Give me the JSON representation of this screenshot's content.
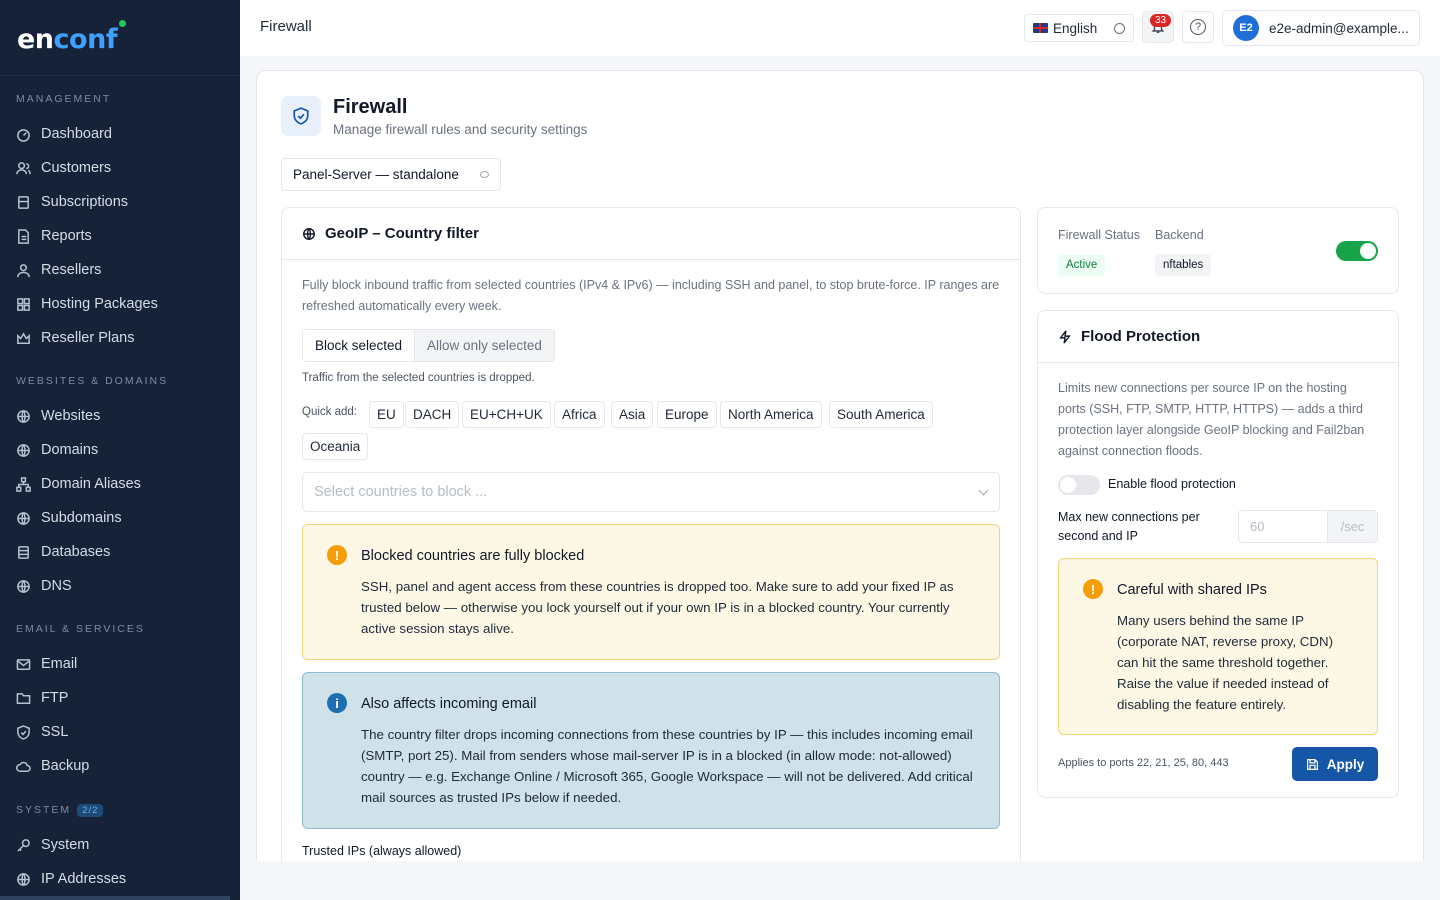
{
  "brand": {
    "part1": "en",
    "part2": "conf"
  },
  "sidebar": {
    "sections": [
      {
        "label": "MANAGEMENT"
      },
      {
        "label": "WEBSITES & DOMAINS"
      },
      {
        "label": "EMAIL & SERVICES"
      },
      {
        "label": "SYSTEM",
        "badge": "2/2"
      }
    ],
    "items": [
      {
        "label": "Dashboard",
        "icon": "dashboard-icon"
      },
      {
        "label": "Customers",
        "icon": "users-icon"
      },
      {
        "label": "Subscriptions",
        "icon": "subscriptions-icon"
      },
      {
        "label": "Reports",
        "icon": "reports-icon"
      },
      {
        "label": "Resellers",
        "icon": "user-icon"
      },
      {
        "label": "Hosting Packages",
        "icon": "grid-icon"
      },
      {
        "label": "Reseller Plans",
        "icon": "crown-icon"
      },
      {
        "label": "Websites",
        "icon": "globe-icon"
      },
      {
        "label": "Domains",
        "icon": "globe-icon"
      },
      {
        "label": "Domain Aliases",
        "icon": "sitemap-icon"
      },
      {
        "label": "Subdomains",
        "icon": "globe-icon"
      },
      {
        "label": "Databases",
        "icon": "database-icon"
      },
      {
        "label": "DNS",
        "icon": "globe-icon"
      },
      {
        "label": "Email",
        "icon": "mail-icon"
      },
      {
        "label": "FTP",
        "icon": "folder-icon"
      },
      {
        "label": "SSL",
        "icon": "shield-icon"
      },
      {
        "label": "Backup",
        "icon": "cloud-icon"
      },
      {
        "label": "System",
        "icon": "key-icon"
      },
      {
        "label": "IP Addresses",
        "icon": "globe-icon"
      }
    ]
  },
  "topbar": {
    "title": "Firewall",
    "language": "English",
    "notifications_count": "33",
    "user_initials": "E2",
    "user_email": "e2e-admin@example..."
  },
  "page": {
    "title": "Firewall",
    "subtitle": "Manage firewall rules and security settings",
    "server": "Panel-Server — standalone"
  },
  "geoip": {
    "title": "GeoIP – Country filter",
    "description": "Fully block inbound traffic from selected countries (IPv4 & IPv6) — including SSH and panel, to stop brute-force. IP ranges are refreshed automatically every week.",
    "mode_block": "Block selected",
    "mode_allow": "Allow only selected",
    "mode_note": "Traffic from the selected countries is dropped.",
    "quick_add_label": "Quick add:",
    "quick_add": [
      "EU",
      "DACH",
      "EU+CH+UK",
      "Africa",
      "Asia",
      "Europe",
      "North America",
      "South America",
      "Oceania"
    ],
    "select_placeholder": "Select countries to block ...",
    "warning_title": "Blocked countries are fully blocked",
    "warning_body": "SSH, panel and agent access from these countries is dropped too. Make sure to add your fixed IP as trusted below — otherwise you lock yourself out if your own IP is in a blocked country. Your currently active session stays alive.",
    "info_title": "Also affects incoming email",
    "info_body": "The country filter drops incoming connections from these countries by IP — this includes incoming email (SMTP, port 25). Mail from senders whose mail-server IP is in a blocked (in allow mode: not-allowed) country — e.g. Exchange Online / Microsoft 365, Google Workspace — will not be delivered. Add critical mail sources as trusted IPs below if needed.",
    "trusted_label": "Trusted IPs (always allowed)"
  },
  "status": {
    "firewall_label": "Firewall Status",
    "firewall_value": "Active",
    "backend_label": "Backend",
    "backend_value": "nftables",
    "enabled": true
  },
  "flood": {
    "title": "Flood Protection",
    "description": "Limits new connections per source IP on the hosting ports (SSH, FTP, SMTP, HTTP, HTTPS) — adds a third protection layer alongside GeoIP blocking and Fail2ban against connection floods.",
    "toggle_label": "Enable flood protection",
    "enabled": false,
    "max_label": "Max new connections per second and IP",
    "max_value": "60",
    "max_unit": "/sec",
    "warn_title": "Careful with shared IPs",
    "warn_body": "Many users behind the same IP (corporate NAT, reverse proxy, CDN) can hit the same threshold together. Raise the value if needed instead of disabling the feature entirely.",
    "ports_note": "Applies to ports 22, 21, 25, 80, 443",
    "apply": "Apply"
  },
  "colors": {
    "sidebar": "#152238",
    "accent": "#1557a6",
    "toggle_on": "#16a34a",
    "warning_bg": "#fdf8e6",
    "info_bg": "#cfe1e9"
  }
}
